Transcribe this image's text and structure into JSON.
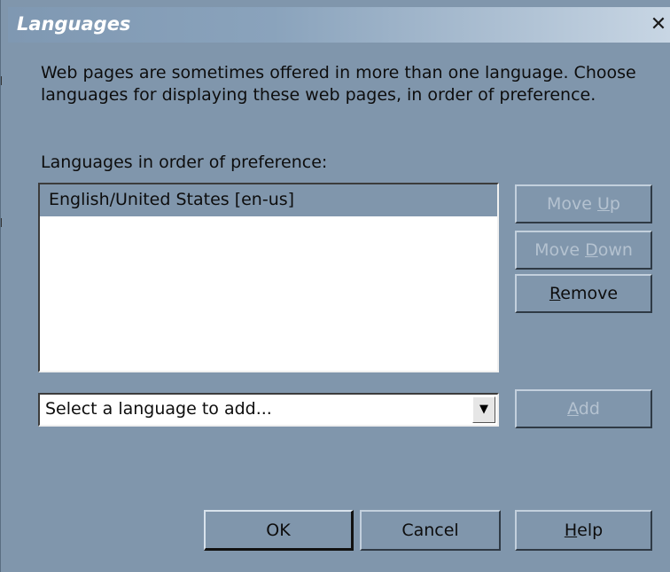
{
  "dialog": {
    "title": "Languages",
    "close_glyph": "✕",
    "description": "Web pages are sometimes offered in more than one language. Choose languages for displaying these web pages, in order of preference.",
    "list_label": "Languages in order of preference:",
    "languages": [
      {
        "label": "English/United States  [en-us]",
        "selected": true
      }
    ],
    "buttons": {
      "move_up": {
        "prefix": "Move ",
        "mnemonic": "U",
        "suffix": "p",
        "enabled": false
      },
      "move_down": {
        "prefix": "Move ",
        "mnemonic": "D",
        "suffix": "own",
        "enabled": false
      },
      "remove": {
        "prefix": "",
        "mnemonic": "R",
        "suffix": "emove",
        "enabled": true
      },
      "add": {
        "prefix": "",
        "mnemonic": "A",
        "suffix": "dd",
        "enabled": false
      },
      "ok": "OK",
      "cancel": "Cancel",
      "help": {
        "prefix": "",
        "mnemonic": "H",
        "suffix": "elp"
      }
    },
    "select": {
      "value": "Select a language to add...",
      "arrow_icon": "dropdown-arrow-icon"
    }
  },
  "colors": {
    "dialog_bg": "#8096ac",
    "title_text": "#ffffff",
    "disabled_text": "#b4c2d0",
    "text": "#0d0d0d"
  }
}
